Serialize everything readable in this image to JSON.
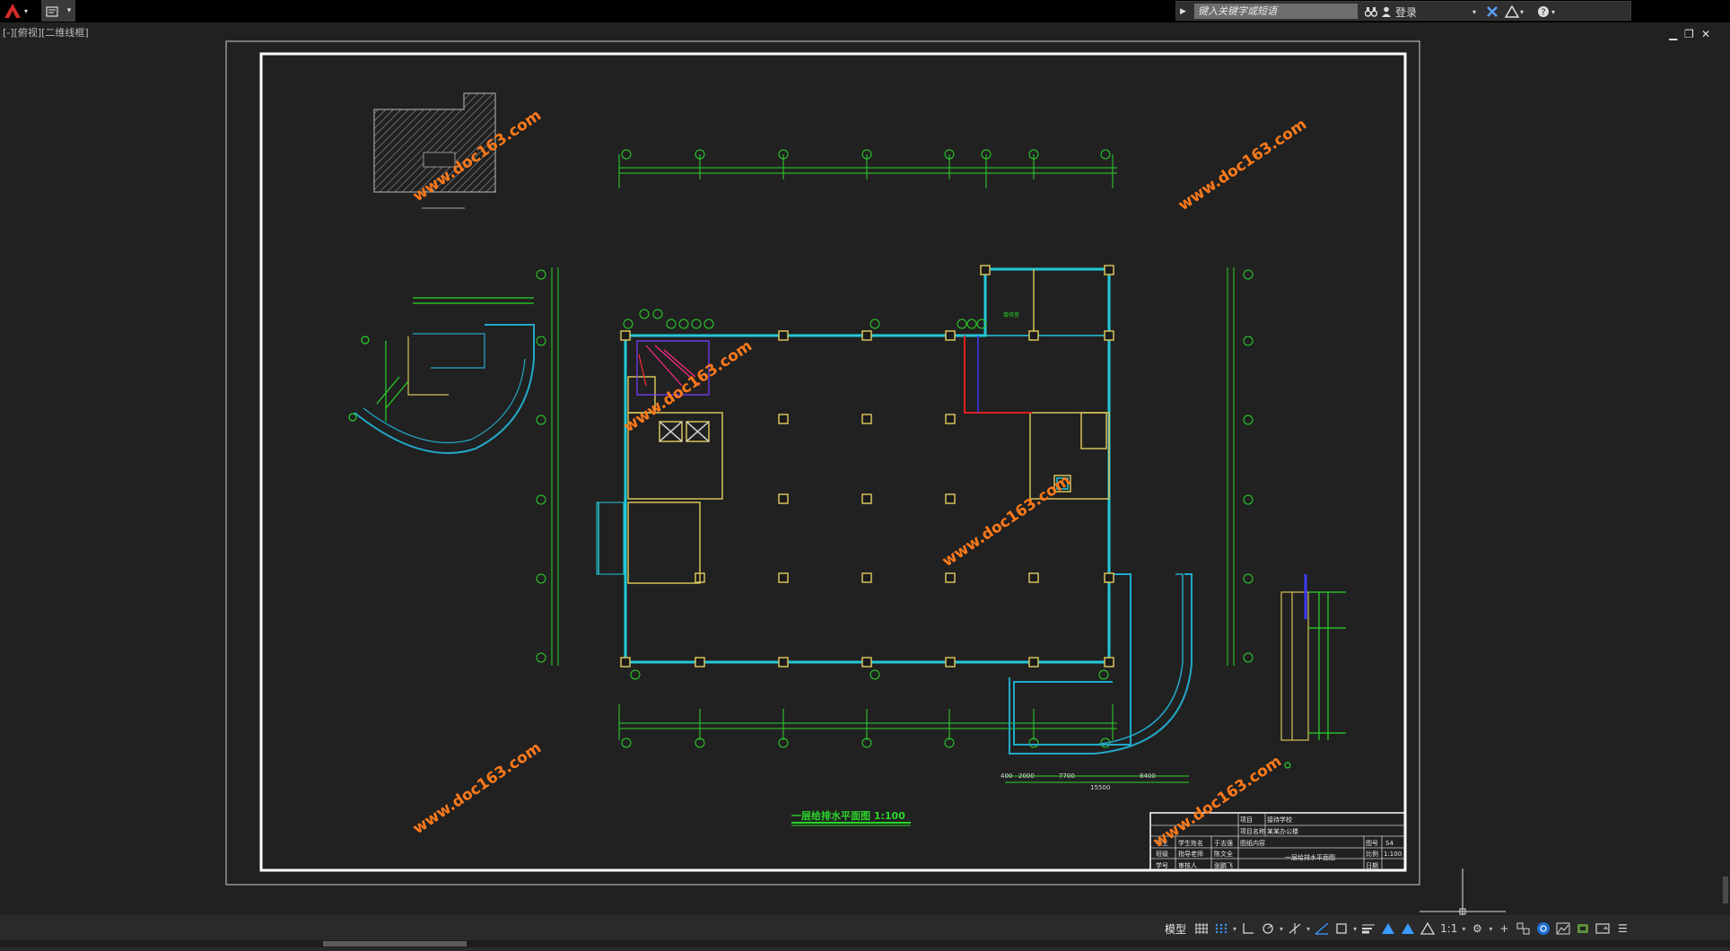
{
  "titlebar": {
    "app_menu_icon": "autocad-logo-icon",
    "search_placeholder": "键入关键字或短语",
    "login_label": "登录"
  },
  "viewport_label": "[-][俯视][二维线框]",
  "drawing": {
    "watermark": "www.doc163.com",
    "plan_title": "一层给排水平面图 1:100",
    "area_label": "接待室",
    "title_block": {
      "project": "项目",
      "project_value": "接待学校",
      "unit": "项目名称",
      "unit_value": "某某办公楼",
      "content_label": "图纸内容",
      "content_value": "一层给排水平面图",
      "drawing_no_label": "图号",
      "drawing_no": "S4",
      "scale_label": "比例",
      "scale": "1:100",
      "date_label": "日期",
      "roles": [
        "学生",
        "班级",
        "学号"
      ],
      "role_values": [
        "学生姓名",
        "指导老师",
        "审核人"
      ],
      "names": [
        "于志强",
        "陈文全",
        "张鹏飞"
      ]
    },
    "dims": {
      "d1": "400",
      "d2": "2000",
      "d3": "7700",
      "d4": "8400",
      "d5": "15500"
    }
  },
  "statusbar": {
    "model_label": "模型",
    "scale_label": "1:1"
  }
}
